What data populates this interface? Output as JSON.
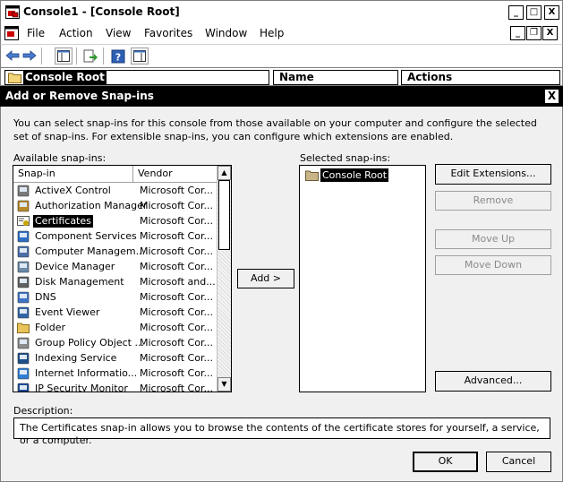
{
  "window": {
    "title": "Console1 - [Console Root]",
    "buttons": {
      "minimize": "_",
      "maximize": "□",
      "close": "X"
    }
  },
  "menubar": {
    "items": [
      "File",
      "Action",
      "View",
      "Favorites",
      "Window",
      "Help"
    ],
    "inner_buttons": {
      "minimize": "_",
      "restore": "❐",
      "close": "X"
    }
  },
  "tree": {
    "root": "Console Root",
    "columns": [
      "Name",
      "Actions"
    ]
  },
  "dialog": {
    "title": "Add or Remove Snap-ins",
    "close": "X",
    "intro": "You can select snap-ins for this console from those available on your computer and configure the selected set of snap-ins. For extensible snap-ins, you can configure which extensions are enabled.",
    "available_label": "Available snap-ins:",
    "selected_label": "Selected snap-ins:",
    "columns": {
      "snapin": "Snap-in",
      "vendor": "Vendor"
    },
    "available": [
      {
        "name": "ActiveX Control",
        "vendor": "Microsoft Cor...",
        "icon": "activex-icon"
      },
      {
        "name": "Authorization Manager",
        "vendor": "Microsoft Cor...",
        "icon": "authorization-icon"
      },
      {
        "name": "Certificates",
        "vendor": "Microsoft Cor...",
        "icon": "certificate-icon",
        "selected": true
      },
      {
        "name": "Component Services",
        "vendor": "Microsoft Cor...",
        "icon": "component-icon"
      },
      {
        "name": "Computer Managem...",
        "vendor": "Microsoft Cor...",
        "icon": "computer-icon"
      },
      {
        "name": "Device Manager",
        "vendor": "Microsoft Cor...",
        "icon": "device-icon"
      },
      {
        "name": "Disk Management",
        "vendor": "Microsoft and...",
        "icon": "disk-icon"
      },
      {
        "name": "DNS",
        "vendor": "Microsoft Cor...",
        "icon": "dns-icon"
      },
      {
        "name": "Event Viewer",
        "vendor": "Microsoft Cor...",
        "icon": "event-icon"
      },
      {
        "name": "Folder",
        "vendor": "Microsoft Cor...",
        "icon": "folder-icon"
      },
      {
        "name": "Group Policy Object ...",
        "vendor": "Microsoft Cor...",
        "icon": "policy-icon"
      },
      {
        "name": "Indexing Service",
        "vendor": "Microsoft Cor...",
        "icon": "indexing-icon"
      },
      {
        "name": "Internet Informatio...",
        "vendor": "Microsoft Cor...",
        "icon": "iis-icon"
      },
      {
        "name": "IP Security Monitor",
        "vendor": "Microsoft Cor...",
        "icon": "ipsec-icon"
      }
    ],
    "selected_items": [
      "Console Root"
    ],
    "add_button": "Add >",
    "buttons": {
      "edit_extensions": "Edit Extensions...",
      "remove": "Remove",
      "move_up": "Move Up",
      "move_down": "Move Down",
      "advanced": "Advanced..."
    },
    "description_label": "Description:",
    "description": "The Certificates snap-in allows you to browse the contents of the certificate stores for yourself, a service, or a computer.",
    "ok": "OK",
    "cancel": "Cancel"
  }
}
